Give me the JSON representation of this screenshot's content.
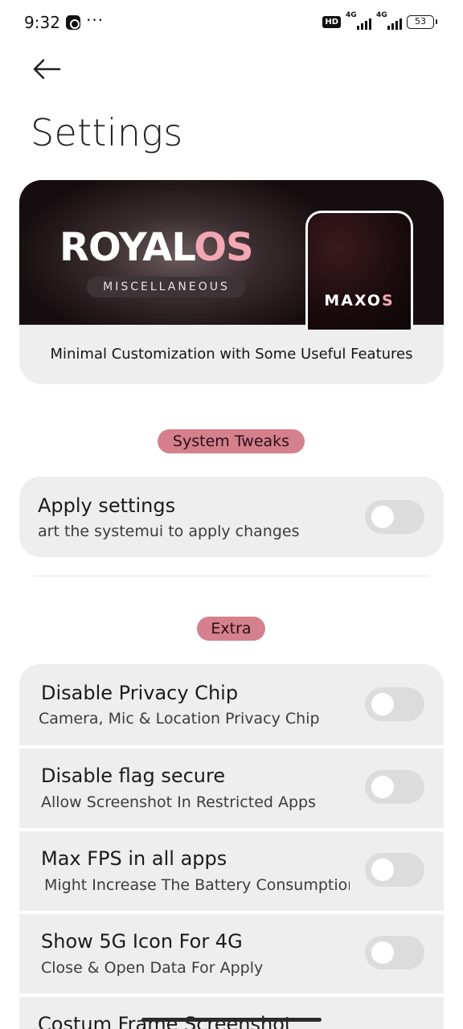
{
  "status_bar": {
    "time": "9:32",
    "overflow": "···",
    "hd": "HD",
    "net1": "4G",
    "net2": "4G",
    "battery": "53"
  },
  "page": {
    "title": "Settings"
  },
  "banner": {
    "brand_white": "ROYAL",
    "brand_pink": "OS",
    "badge": "MISCELLANEOUS",
    "phone_brand_white": "MAXO",
    "phone_brand_pink": "S",
    "caption": "Minimal Customization with Some Useful Features"
  },
  "sections": {
    "system_tweaks": "System Tweaks",
    "extra": "Extra"
  },
  "apply": {
    "title": "Apply settings",
    "subtitle": "art the systemui to apply changes",
    "enabled": false
  },
  "extra_items": [
    {
      "title": "Disable Privacy Chip",
      "subtitle": "Camera, Mic & Location Privacy Chip",
      "enabled": false
    },
    {
      "title": "Disable flag secure",
      "subtitle": "Allow Screenshot In Restricted Apps",
      "enabled": false
    },
    {
      "title": "Max FPS in all apps",
      "subtitle": "Might Increase The Battery Consumption",
      "enabled": false
    },
    {
      "title": "Show 5G Icon For 4G",
      "subtitle": "Close & Open Data For Apply",
      "enabled": false
    },
    {
      "title": "Costum Frame Screenshot",
      "subtitle": "",
      "enabled": false
    }
  ],
  "colors": {
    "accent_chip": "#d5808d",
    "brand_pink": "#f3a7b2",
    "card_bg": "#eeeeee",
    "toggle_off": "#dcdcdc"
  }
}
